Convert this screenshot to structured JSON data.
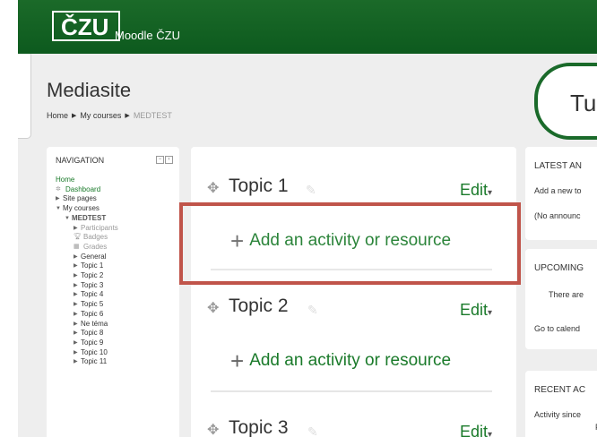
{
  "header": {
    "logo_text": "ČZU",
    "site_name": "Moodle ČZU"
  },
  "page": {
    "title": "Mediasite",
    "breadcrumb": [
      "Home",
      "My courses",
      "MEDTEST"
    ]
  },
  "right_pill": {
    "text": "Tu"
  },
  "navigation": {
    "title": "NAVIGATION",
    "items": [
      {
        "label": "Home"
      },
      {
        "label": "Dashboard"
      },
      {
        "label": "Site pages"
      },
      {
        "label": "My courses"
      },
      {
        "label": "MEDTEST"
      },
      {
        "label": "Participants"
      },
      {
        "label": "Badges"
      },
      {
        "label": "Grades"
      },
      {
        "label": "General"
      },
      {
        "label": "Topic 1"
      },
      {
        "label": "Topic 2"
      },
      {
        "label": "Topic 3"
      },
      {
        "label": "Topic 4"
      },
      {
        "label": "Topic 5"
      },
      {
        "label": "Topic 6"
      },
      {
        "label": "Ne téma"
      },
      {
        "label": "Topic 8"
      },
      {
        "label": "Topic 9"
      },
      {
        "label": "Topic 10"
      },
      {
        "label": "Topic 11"
      }
    ]
  },
  "main": {
    "topics": [
      {
        "title": "Topic 1",
        "edit_label": "Edit",
        "add_label": "Add an activity or resource"
      },
      {
        "title": "Topic 2",
        "edit_label": "Edit",
        "add_label": "Add an activity or resource"
      },
      {
        "title": "Topic 3",
        "edit_label": "Edit"
      }
    ]
  },
  "right_blocks": {
    "announcements": {
      "title": "LATEST AN",
      "line1": "Add a new to",
      "line2": "(No announc"
    },
    "upcoming": {
      "title": "UPCOMING",
      "line1": "There are",
      "line2": "Go to calend"
    },
    "recent": {
      "title": "RECENT AC",
      "line1": "Activity since",
      "line2": "F"
    }
  },
  "colors": {
    "header_green": "#0d5a1e",
    "link_green": "#1a7a2a",
    "highlight": "#c0544a"
  },
  "icons": {
    "move": "move-icon",
    "edit_pencil": "pencil-icon",
    "add": "plus-icon",
    "dashboard": "dashboard-icon",
    "badges": "badge-icon",
    "grades": "grades-icon"
  }
}
